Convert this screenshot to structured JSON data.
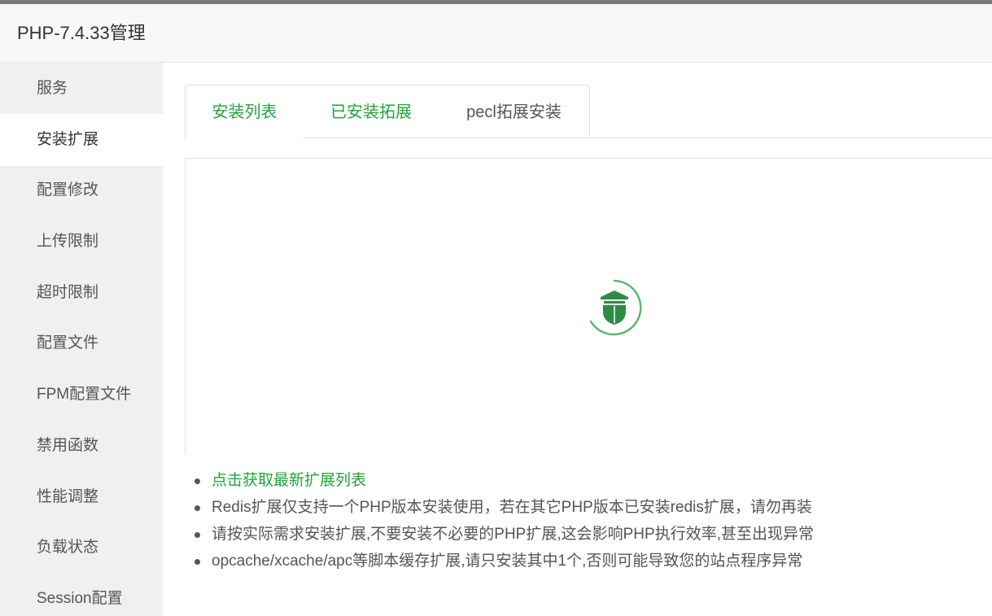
{
  "window": {
    "title": "PHP-7.4.33管理"
  },
  "sidebar": {
    "items": [
      {
        "label": "服务"
      },
      {
        "label": "安装扩展",
        "active": true
      },
      {
        "label": "配置修改"
      },
      {
        "label": "上传限制"
      },
      {
        "label": "超时限制"
      },
      {
        "label": "配置文件"
      },
      {
        "label": "FPM配置文件"
      },
      {
        "label": "禁用函数"
      },
      {
        "label": "性能调整"
      },
      {
        "label": "负载状态"
      },
      {
        "label": "Session配置"
      }
    ]
  },
  "tabs": [
    {
      "label": "安装列表",
      "active": true
    },
    {
      "label": "已安装拓展"
    },
    {
      "label": "pecl拓展安装"
    }
  ],
  "panel": {
    "loading": true,
    "loader_icon": "loading-spinner-icon"
  },
  "tips": [
    "点击获取最新扩展列表",
    "Redis扩展仅支持一个PHP版本安装使用，若在其它PHP版本已安装redis扩展，请勿再装",
    "请按实际需求安装扩展,不要安装不必要的PHP扩展,这会影响PHP执行效率,甚至出现异常",
    "opcache/xcache/apc等脚本缓存扩展,请只安装其中1个,否则可能导致您的站点程序异常"
  ],
  "colors": {
    "accent": "#20a53a",
    "sidebar_bg": "#f0f0f0",
    "header_bg": "#f8f8f8"
  }
}
